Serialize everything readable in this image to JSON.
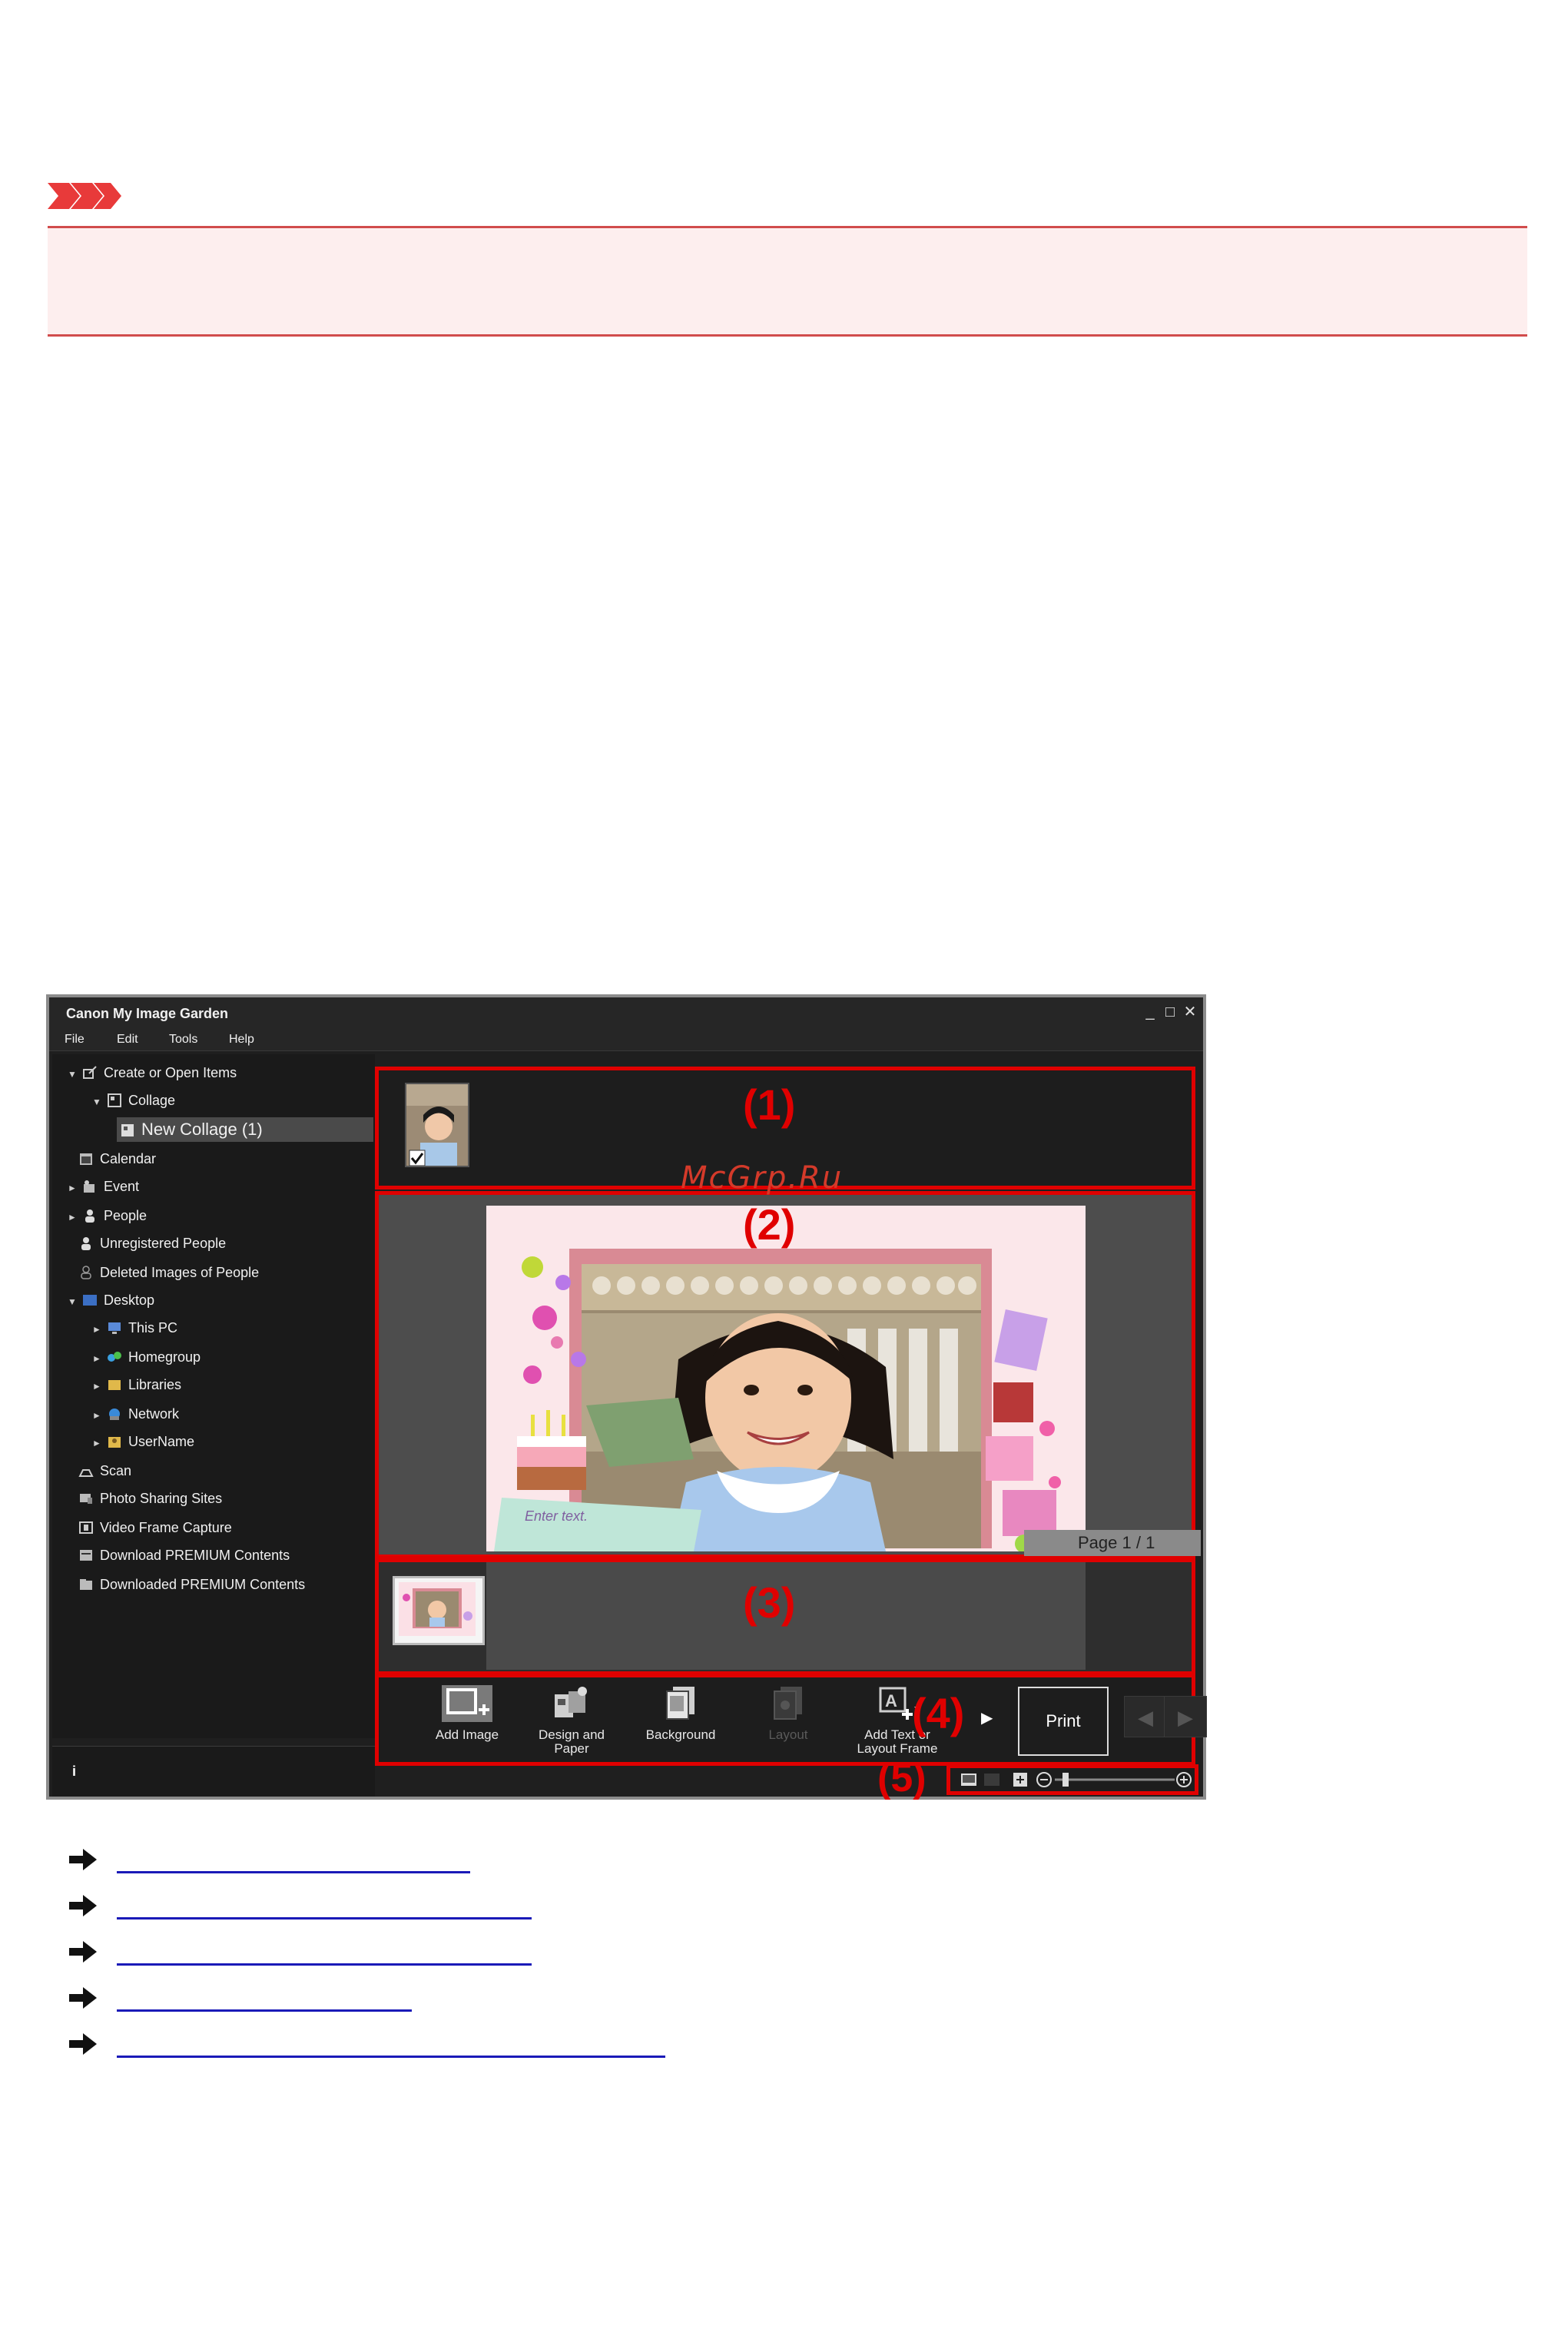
{
  "window": {
    "title": "Canon My Image Garden",
    "controls": [
      "_",
      "□",
      "✕"
    ]
  },
  "menu": [
    "File",
    "Edit",
    "Tools",
    "Help"
  ],
  "sidebar": {
    "items": [
      {
        "label": "Create or Open Items",
        "icon": "create-items-icon",
        "arrow": "▼"
      },
      {
        "label": "Collage",
        "icon": "collage-icon",
        "arrow": "▼"
      },
      {
        "label": "New Collage (1)",
        "icon": "collage-file-icon",
        "arrow": ""
      },
      {
        "label": "Calendar",
        "icon": "calendar-icon",
        "arrow": ""
      },
      {
        "label": "Event",
        "icon": "event-icon",
        "arrow": "►"
      },
      {
        "label": "People",
        "icon": "people-icon",
        "arrow": "►"
      },
      {
        "label": "Unregistered People",
        "icon": "unregistered-people-icon",
        "arrow": ""
      },
      {
        "label": "Deleted Images of People",
        "icon": "deleted-people-icon",
        "arrow": ""
      },
      {
        "label": "Desktop",
        "icon": "desktop-icon",
        "arrow": "▼"
      },
      {
        "label": "This PC",
        "icon": "this-pc-icon",
        "arrow": "►"
      },
      {
        "label": "Homegroup",
        "icon": "homegroup-icon",
        "arrow": "►"
      },
      {
        "label": "Libraries",
        "icon": "libraries-icon",
        "arrow": "►"
      },
      {
        "label": "Network",
        "icon": "network-icon",
        "arrow": "►"
      },
      {
        "label": "UserName",
        "icon": "user-folder-icon",
        "arrow": "►"
      },
      {
        "label": "Scan",
        "icon": "scan-icon",
        "arrow": ""
      },
      {
        "label": "Photo Sharing Sites",
        "icon": "photo-sharing-icon",
        "arrow": ""
      },
      {
        "label": "Video Frame Capture",
        "icon": "video-frame-icon",
        "arrow": ""
      },
      {
        "label": "Download PREMIUM Contents",
        "icon": "download-premium-icon",
        "arrow": ""
      },
      {
        "label": "Downloaded PREMIUM Contents",
        "icon": "downloaded-premium-icon",
        "arrow": ""
      }
    ]
  },
  "callouts": [
    "(1)",
    "(2)",
    "(3)",
    "(4)",
    "(5)"
  ],
  "watermark": "McGrp.Ru",
  "preview": {
    "enter_text": "Enter text.",
    "page_label": "Page 1 / 1"
  },
  "toolbar": {
    "add_image": "Add Image",
    "design_paper": "Design and Paper",
    "background": "Background",
    "layout": "Layout",
    "add_text": "Add Text or Layout Frame",
    "print": "Print"
  },
  "colors": {
    "highlight_red": "#e00000",
    "important_bg": "#fdeeee",
    "important_border": "#d14c4c",
    "link_blue": "#1a1ab8"
  }
}
